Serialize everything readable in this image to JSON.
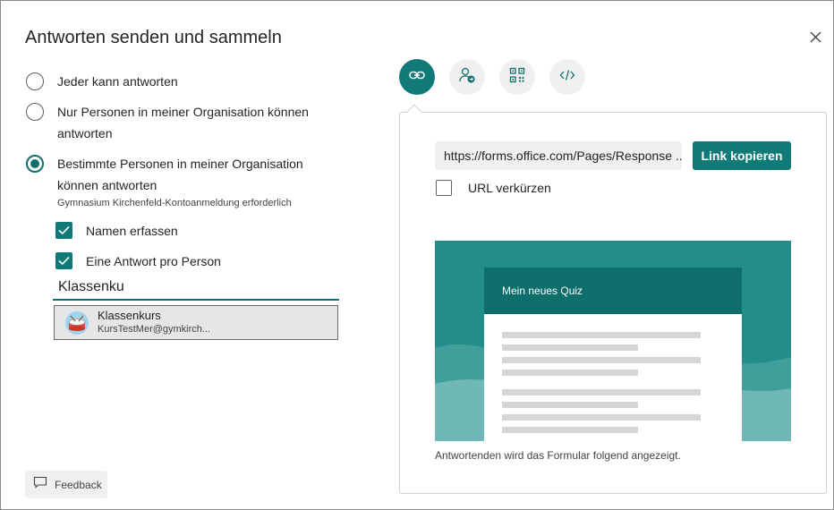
{
  "dialog": {
    "title": "Antworten senden und sammeln"
  },
  "options": {
    "anyone": "Jeder kann antworten",
    "org": "Nur Personen in meiner Organisation können antworten",
    "specific": "Bestimmte Personen in meiner Organisation können antworten",
    "note": "Gymnasium Kirchenfeld-Kontoanmeldung erforderlich",
    "selected": "specific"
  },
  "checks": {
    "record_names": "Namen erfassen",
    "one_response": "Eine Antwort pro Person"
  },
  "search": {
    "value": "Klassenku"
  },
  "suggestion": {
    "name": "Klassenkurs",
    "email": "KursTestMer@gymkirch..."
  },
  "feedback": {
    "label": "Feedback"
  },
  "tabs": [
    {
      "icon": "link-icon",
      "active": true
    },
    {
      "icon": "person-add-icon",
      "active": false
    },
    {
      "icon": "qr-code-icon",
      "active": false
    },
    {
      "icon": "embed-code-icon",
      "active": false
    }
  ],
  "share": {
    "url": "https://forms.office.com/Pages/Response ...",
    "copy_label": "Link kopieren",
    "shorten_label": "URL verkürzen"
  },
  "preview": {
    "form_title": "Mein neues Quiz",
    "caption": "Antwortenden wird das Formular folgend angezeigt."
  },
  "colors": {
    "accent": "#0f7a77",
    "accent_dark": "#0d6e6c"
  }
}
